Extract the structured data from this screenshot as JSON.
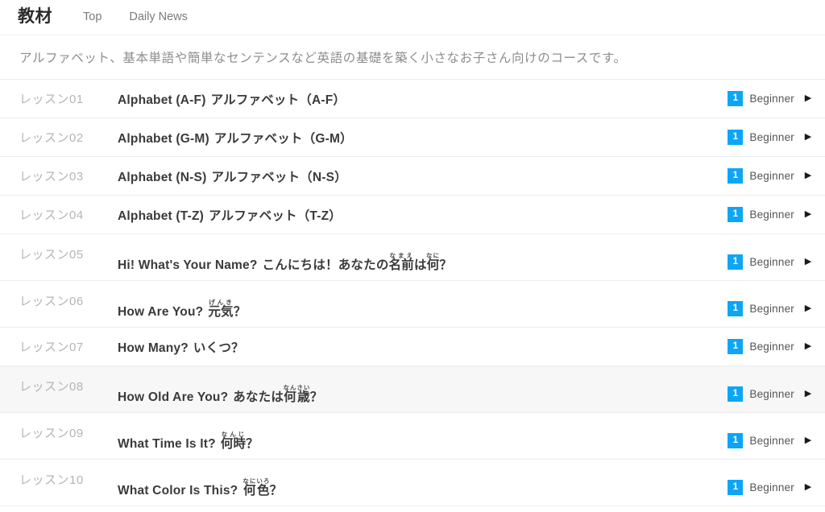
{
  "header": {
    "brand": "教材",
    "nav": [
      {
        "label": "Top",
        "name": "nav-link-top"
      },
      {
        "label": "Daily News",
        "name": "nav-link-daily-news"
      }
    ]
  },
  "course": {
    "description": "アルファベット、基本単語や簡単なセンテンスなど英語の基礎を築く小さなお子さん向けのコースです。"
  },
  "theme": {
    "badge_blue": "#0ea5f7",
    "row_hover_bg": "#f7f7f7",
    "divider": "#ececec",
    "lesson_num_color": "#b5b5b5",
    "desc_color": "#8d8d8d"
  },
  "list": {
    "level_badge_text": "1",
    "level_label": "Beginner",
    "chevron_icon": "▶",
    "lessons": [
      {
        "num": "レッスン01",
        "title_en": "Alphabet (A-F)",
        "title_ja": "アルファベット（A-F）",
        "ruby": [],
        "active": false
      },
      {
        "num": "レッスン02",
        "title_en": "Alphabet (G-M)",
        "title_ja": "アルファベット（G-M）",
        "ruby": [],
        "active": false
      },
      {
        "num": "レッスン03",
        "title_en": "Alphabet (N-S)",
        "title_ja": "アルファベット（N-S）",
        "ruby": [],
        "active": false
      },
      {
        "num": "レッスン04",
        "title_en": "Alphabet (T-Z)",
        "title_ja": "アルファベット（T-Z）",
        "ruby": [],
        "active": false
      },
      {
        "num": "レッスン05",
        "title_en": "Hi! What's Your Name?",
        "title_ja": "こんにちは！あなたの名前は何？",
        "ruby": [
          {
            "base": "名前",
            "reading": "なまえ"
          },
          {
            "base": "何",
            "reading": "なに"
          }
        ],
        "active": false
      },
      {
        "num": "レッスン06",
        "title_en": "How Are You?",
        "title_ja": "元気？",
        "ruby": [
          {
            "base": "元気",
            "reading": "げんき"
          }
        ],
        "active": false
      },
      {
        "num": "レッスン07",
        "title_en": "How Many?",
        "title_ja": "いくつ？",
        "ruby": [],
        "active": false
      },
      {
        "num": "レッスン08",
        "title_en": "How Old Are You?",
        "title_ja": "あなたは何歳？",
        "ruby": [
          {
            "base": "何歳",
            "reading": "なんさい"
          }
        ],
        "active": true
      },
      {
        "num": "レッスン09",
        "title_en": "What Time Is It?",
        "title_ja": "何時？",
        "ruby": [
          {
            "base": "何時",
            "reading": "なんじ"
          }
        ],
        "active": false
      },
      {
        "num": "レッスン10",
        "title_en": "What Color Is This?",
        "title_ja": "何色？",
        "ruby": [
          {
            "base": "何色",
            "reading": "なにいろ"
          }
        ],
        "active": false
      }
    ]
  }
}
